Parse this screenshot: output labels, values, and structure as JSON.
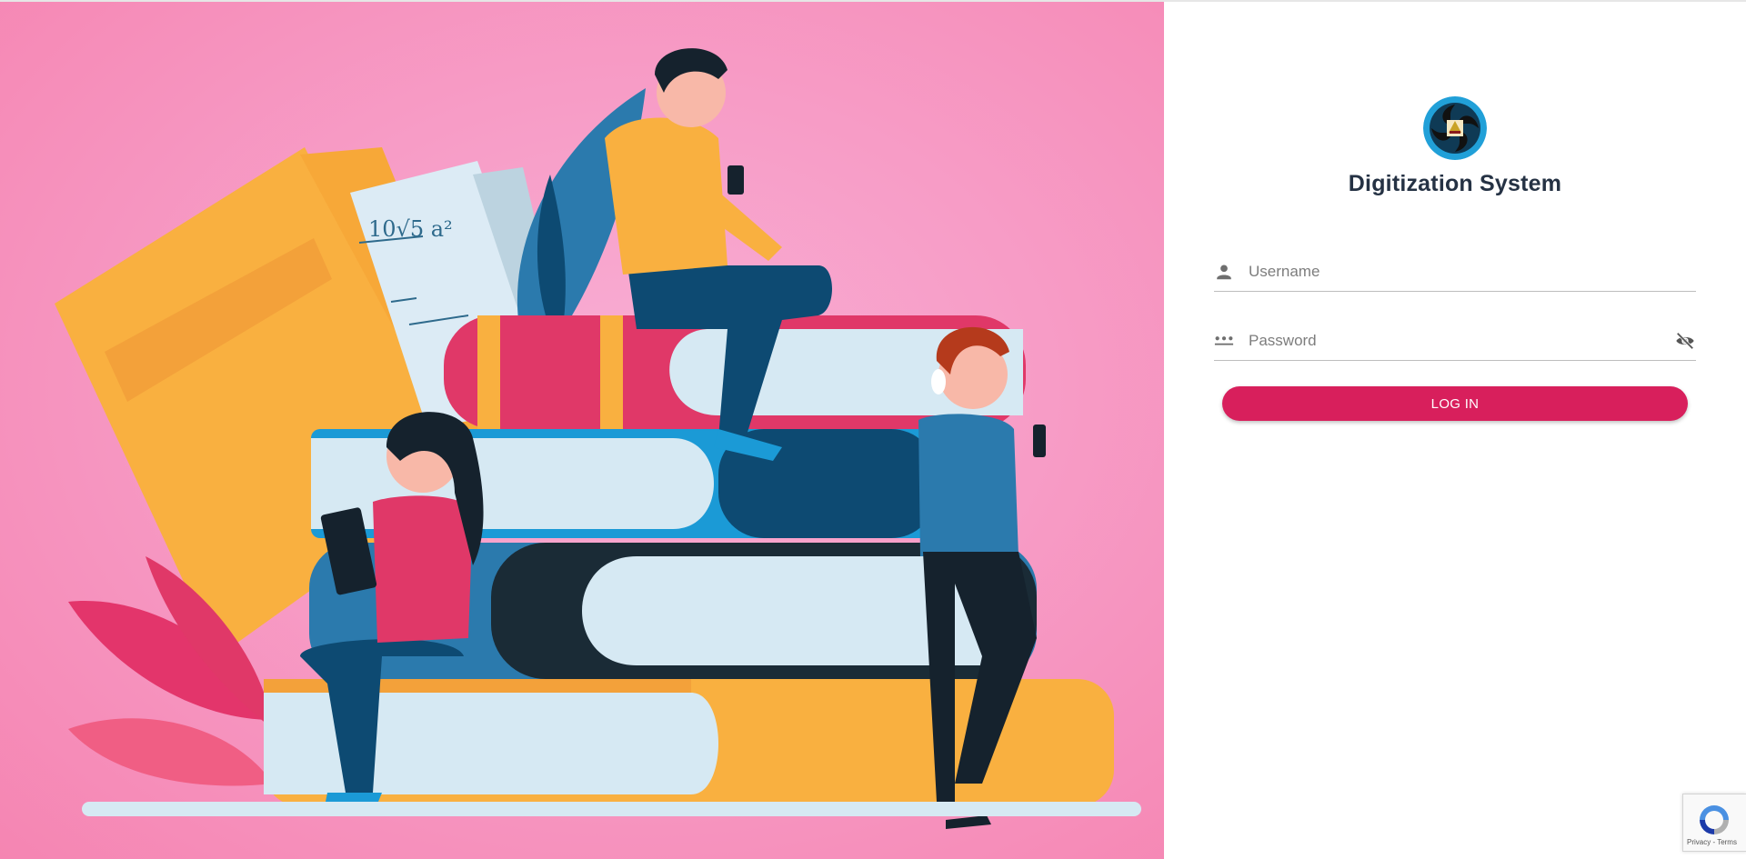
{
  "app": {
    "title": "Digitization System",
    "logo": "digitization-system-logo"
  },
  "form": {
    "username": {
      "placeholder": "Username",
      "value": "",
      "icon": "person-icon"
    },
    "password": {
      "placeholder": "Password",
      "value": "",
      "icon": "password-dots-icon",
      "toggle_icon": "eye-off-icon"
    },
    "login_label": "LOG IN"
  },
  "recaptcha": {
    "links": "Privacy - Terms",
    "icon": "recaptcha-icon"
  },
  "colors": {
    "accent": "#d81f5c",
    "title": "#253244",
    "hero_background": "#f79cc6"
  },
  "hero": {
    "illustration": "people-reading-on-stacked-books"
  }
}
